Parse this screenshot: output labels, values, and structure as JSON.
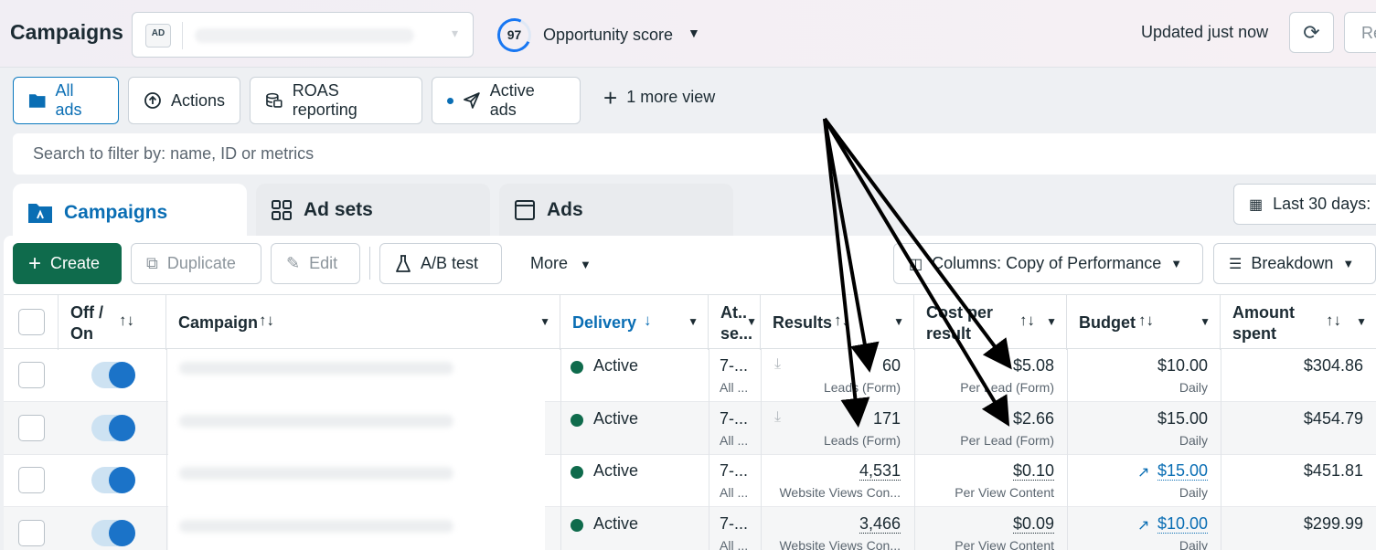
{
  "header": {
    "title": "Campaigns",
    "account_logo_text": "AD",
    "opportunity_score": "97",
    "opportunity_label": "Opportunity score",
    "updated": "Updated just now",
    "review_label": "Re"
  },
  "views": [
    {
      "label": "All ads",
      "icon": "folder-icon"
    },
    {
      "label": "Actions",
      "icon": "actions-icon"
    },
    {
      "label": "ROAS reporting",
      "icon": "coins-icon"
    },
    {
      "label": "Active ads",
      "icon": "send-icon"
    }
  ],
  "more_views": "1 more view",
  "search": {
    "placeholder": "Search to filter by: name, ID or metrics"
  },
  "levels": [
    {
      "label": "Campaigns",
      "icon": "campaign-folder-icon"
    },
    {
      "label": "Ad sets",
      "icon": "grid-icon"
    },
    {
      "label": "Ads",
      "icon": "ad-icon"
    }
  ],
  "date_range": "Last 30 days:",
  "toolbar": {
    "create": "Create",
    "duplicate": "Duplicate",
    "edit": "Edit",
    "ab_test": "A/B test",
    "more": "More",
    "columns": "Columns: Copy of Performance",
    "breakdown": "Breakdown"
  },
  "columns": {
    "offon": [
      "Off /",
      "On"
    ],
    "campaign": "Campaign",
    "delivery": "Delivery",
    "attribution": [
      "At..",
      "se..."
    ],
    "results": "Results",
    "cost": [
      "Cost per",
      "result"
    ],
    "budget": "Budget",
    "spent": [
      "Amount",
      "spent"
    ]
  },
  "rows": [
    {
      "status": "Active",
      "attr1": "7-...",
      "attr2": "All ...",
      "result": "60",
      "result_type": "Leads (Form)",
      "cost": "$5.08",
      "cost_type": "Per Lead (Form)",
      "budget": "$10.00",
      "budget_type": "Daily",
      "spent": "$304.86",
      "download": true,
      "dotted": false,
      "budget_link": false
    },
    {
      "status": "Active",
      "attr1": "7-...",
      "attr2": "All ...",
      "result": "171",
      "result_type": "Leads (Form)",
      "cost": "$2.66",
      "cost_type": "Per Lead (Form)",
      "budget": "$15.00",
      "budget_type": "Daily",
      "spent": "$454.79",
      "download": true,
      "dotted": false,
      "budget_link": false
    },
    {
      "status": "Active",
      "attr1": "7-...",
      "attr2": "All ...",
      "result": "4,531",
      "result_type": "Website Views Con...",
      "cost": "$0.10",
      "cost_type": "Per View Content",
      "budget": "$15.00",
      "budget_type": "Daily",
      "spent": "$451.81",
      "download": false,
      "dotted": true,
      "budget_link": true
    },
    {
      "status": "Active",
      "attr1": "7-...",
      "attr2": "All ...",
      "result": "3,466",
      "result_type": "Website Views Con...",
      "cost": "$0.09",
      "cost_type": "Per View Content",
      "budget": "$10.00",
      "budget_type": "Daily",
      "spent": "$299.99",
      "download": false,
      "dotted": true,
      "budget_link": true
    }
  ],
  "colors": {
    "accent": "#0a6eb4",
    "create": "#0f6b4c",
    "active_dot": "#0f6b4c"
  }
}
